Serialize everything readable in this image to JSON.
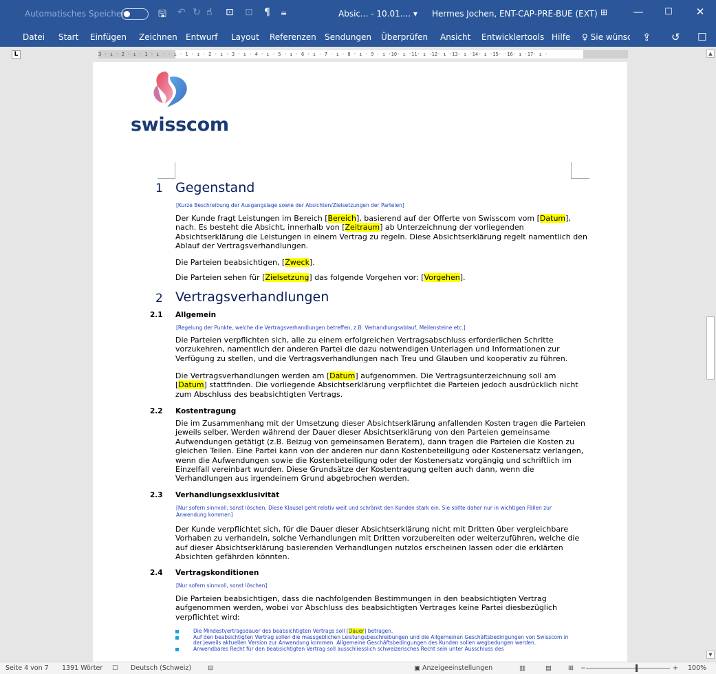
{
  "titlebar": {
    "autosave_label": "Automatisches Speichern",
    "autosave_state": "off",
    "doc_title": "Absic... - 10.01.... ▾",
    "user": "Hermes Jochen, ENT-CAP-PRE-BUE (EXT)"
  },
  "menu": {
    "items": [
      "Datei",
      "Start",
      "Einfügen",
      "Zeichnen",
      "Entwurf",
      "Layout",
      "Referenzen",
      "Sendungen",
      "Überprüfen",
      "Ansicht",
      "Entwicklertools",
      "Hilfe"
    ],
    "search_placeholder": "Sie wünsc"
  },
  "ruler": {
    "text": "3 · ı · 2 · ı · 1 · ı ·   · ı · 1 · ı · 2 · ı · 3 · ı · 4 · ı · 5 · ı · 6 · ı · 7 · ı · 8 · ı · 9 · ı ·10· ı ·11· ı ·12· ı ·13· ı ·14· ı ·15·   ·16· ı ·17· ı ·"
  },
  "document": {
    "logo_text": "swisscom",
    "s1": {
      "num": "1",
      "title": "Gegenstand",
      "hint": "[Kurze Beschreibung der Ausgangslage sowie der Absichten/Zielsetzungen der Parteien]",
      "p1": {
        "t1": "Der Kunde fragt Leistungen im Bereich [",
        "h1": "Bereich",
        "t2": "], basierend auf der Offerte von Swisscom vom [",
        "h2": "Datum",
        "t3": "], nach. Es besteht die Absicht, innerhalb von [",
        "h3": "Zeitraum",
        "t4": "] ab Unterzeichnung der vorliegenden Absichtserklärung die Leistungen in einem Vertrag zu regeln. Diese Absichtserklärung regelt namentlich den Ablauf der Vertragsverhandlungen."
      },
      "p2": {
        "t1": "Die Parteien beabsichtigen, [",
        "h1": "Zweck",
        "t2": "]."
      },
      "p3": {
        "t1": "Die Parteien sehen für [",
        "h1": "Zielsetzung",
        "t2": "] das folgende Vorgehen vor: [",
        "h2": "Vorgehen",
        "t3": "]."
      }
    },
    "s2": {
      "num": "2",
      "title": "Vertragsverhandlungen",
      "s21": {
        "num": "2.1",
        "title": "Allgemein",
        "hint": "[Regelung der Punkte, welche die Vertragsverhandlungen betreffen, z.B. Verhandlungsablauf, Meilensteine etc.]",
        "p1": "Die Parteien verpflichten sich, alle zu einem erfolgreichen Vertragsabschluss erforderlichen Schritte vorzukehren, namentlich der anderen Partei die dazu notwendigen Unterlagen und Informationen zur Verfügung zu stellen, und die Vertragsverhandlungen nach Treu und Glauben und kooperativ zu führen.",
        "p2": {
          "t1": "Die Vertragsverhandlungen werden am [",
          "h1": "Datum",
          "t2": "] aufgenommen. Die Vertragsunterzeichnung soll am [",
          "h2": "Datum",
          "t3": "] stattfinden. Die vorliegende Absichtserklärung verpflichtet die Parteien jedoch ausdrücklich nicht zum Abschluss des beabsichtigten Vertrags."
        }
      },
      "s22": {
        "num": "2.2",
        "title": "Kostentragung",
        "p1": "Die im Zusammenhang mit der Umsetzung dieser Absichtserklärung anfallenden Kosten tragen die Parteien jeweils selber. Werden während der Dauer dieser Absichtserklärung von den Parteien gemeinsame Aufwendungen getätigt (z.B. Beizug von gemeinsamen Beratern), dann tragen die Parteien die Kosten zu gleichen Teilen. Eine Partei kann von der anderen nur dann Kostenbeteiligung oder Kostenersatz verlangen, wenn die Aufwendungen sowie die Kostenbeteiligung oder der Kostenersatz vorgängig und schriftlich im Einzelfall vereinbart wurden. Diese Grundsätze der Kostentragung gelten auch dann, wenn die Verhandlungen aus irgendeinem Grund abgebrochen werden."
      },
      "s23": {
        "num": "2.3",
        "title": "Verhandlungsexklusivität",
        "hint": "[Nur sofern sinnvoll, sonst löschen. Diese Klausel geht relativ weit und schränkt den Kunden stark ein. Sie sollte daher nur in wichtigen Fällen zur Anwendung kommen]",
        "p1": "Der Kunde verpflichtet sich, für die Dauer dieser Absichtserklärung nicht mit Dritten über vergleichbare Vorhaben zu verhandeln, solche Verhandlungen mit Dritten vorzubereiten oder weiterzuführen, welche die auf dieser Absichtserklärung basierenden Verhandlungen nutzlos erscheinen lassen oder die erklärten Absichten gefährden könnten."
      },
      "s24": {
        "num": "2.4",
        "title": "Vertragskonditionen",
        "hint": "[Nur sofern sinnvoll, sonst löschen]",
        "p1": "Die Parteien beabsichtigen, dass die nachfolgenden Bestimmungen in den beabsichtigten Vertrag aufgenommen werden, wobei vor Abschluss des beabsichtigten Vertrages keine Partei diesbezüglich verpflichtet wird:",
        "b1": {
          "t1": "Die Mindestvertragsdauer des beabsichtigten Vertrags soll [",
          "h1": "Dauer",
          "t2": "] betragen."
        },
        "b2": "Auf den beabsichtigten Vertrag sollen die massgeblichen Leistungsbeschreibungen und die Allgemeinen Geschäftsbedingungen von Swisscom in der jeweils aktuellen Version zur Anwendung kommen. Allgemeine Geschäftsbedingungen des Kunden sollen wegbedungen werden.",
        "b3": "Anwendbares Recht für den beabsichtigten Vertrag soll ausschliesslich schweizerisches Recht sein unter Ausschluss des"
      }
    }
  },
  "statusbar": {
    "page": "Seite 4 von 7",
    "words": "1391 Wörter",
    "language": "Deutsch (Schweiz)",
    "display_settings": "Anzeigeeinstellungen",
    "zoom": "100%",
    "zoom_level": 100
  }
}
